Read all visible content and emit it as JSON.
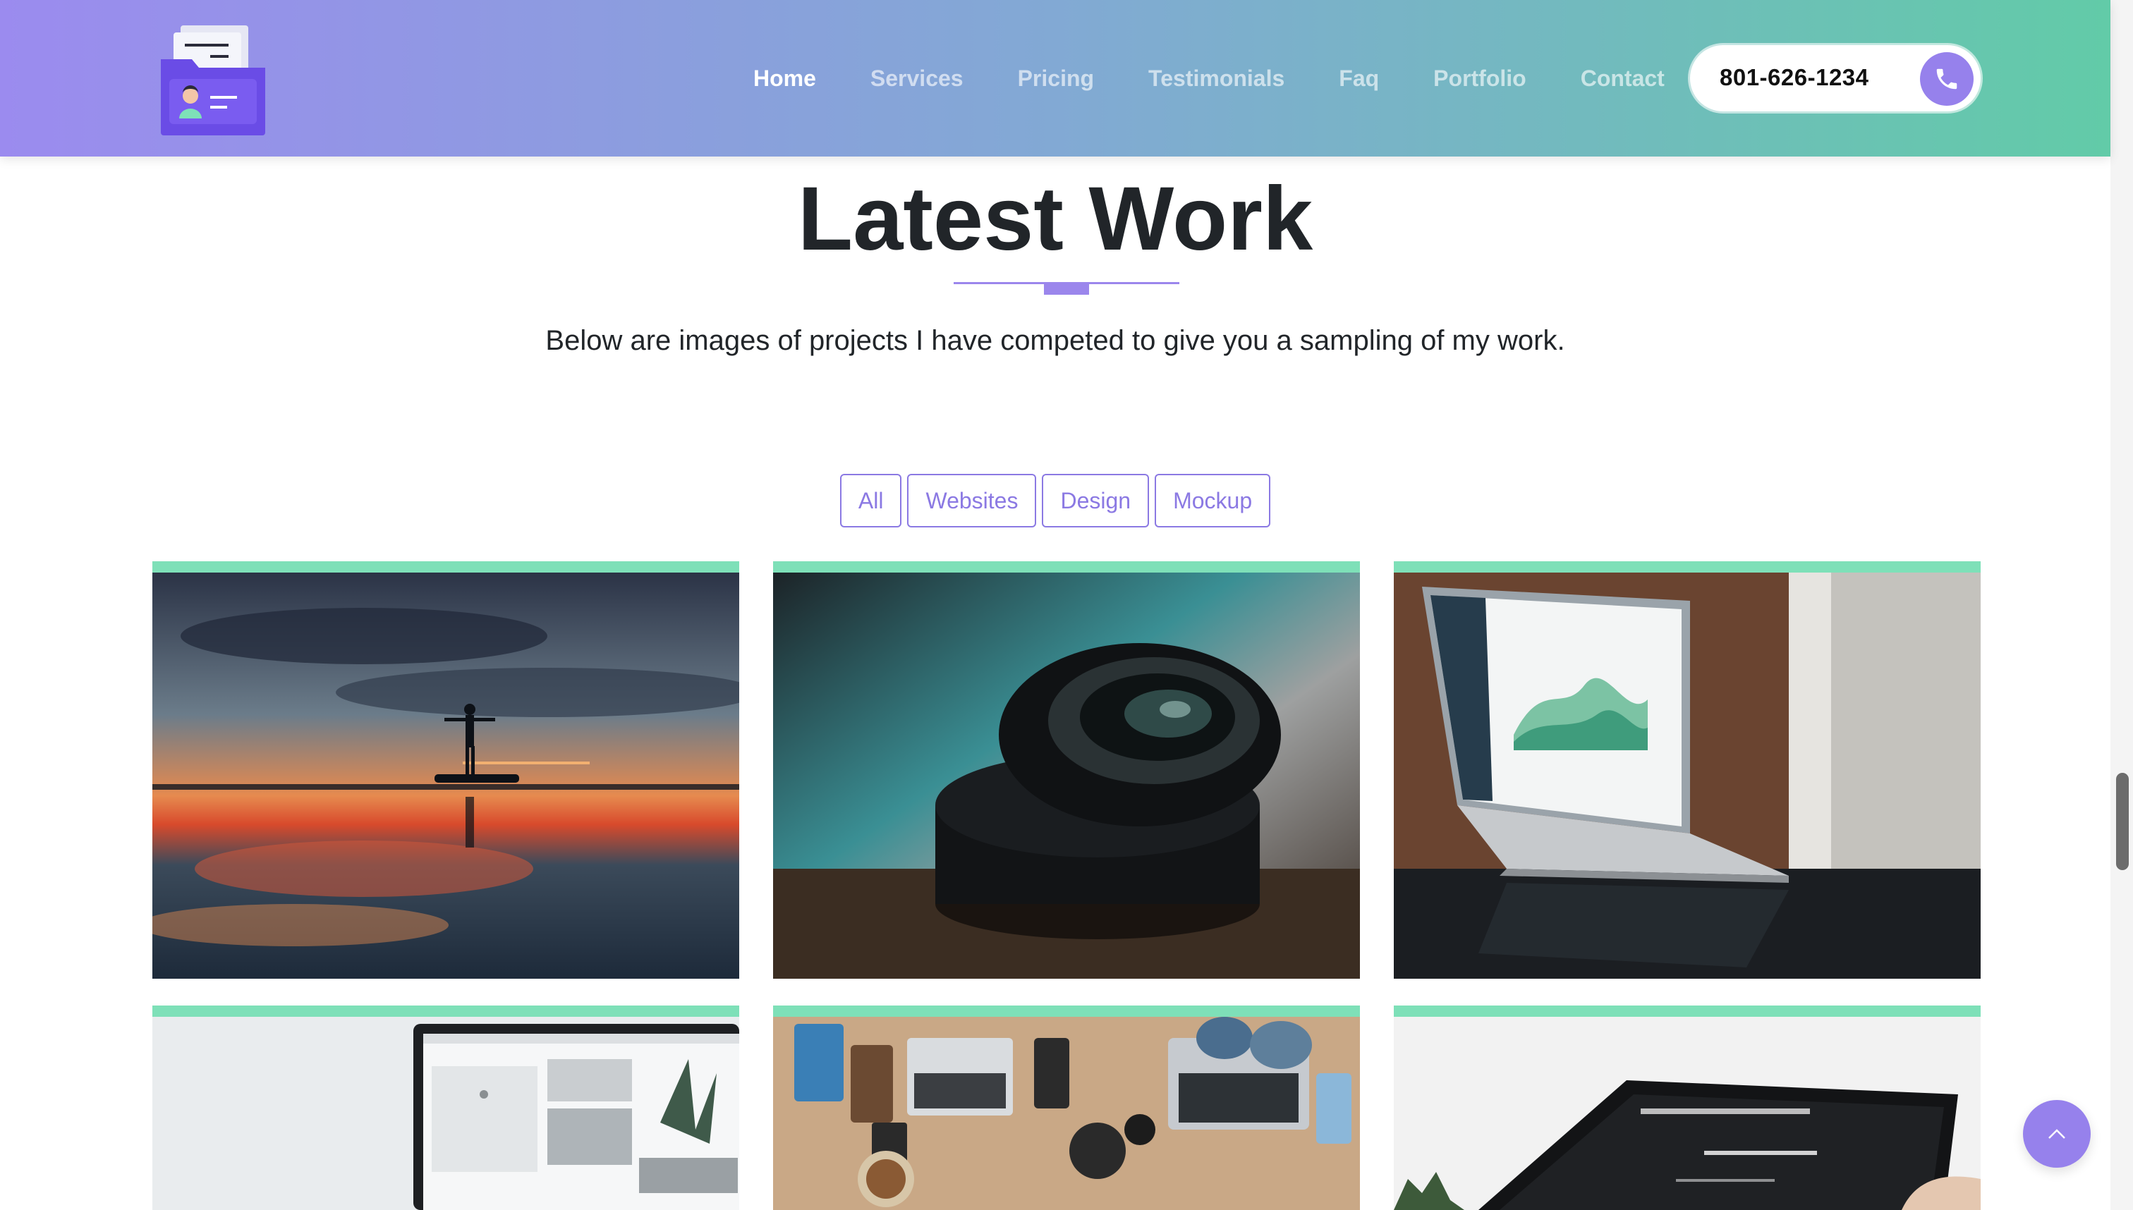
{
  "nav": {
    "items": [
      {
        "label": "Home",
        "active": true
      },
      {
        "label": "Services",
        "active": false
      },
      {
        "label": "Pricing",
        "active": false
      },
      {
        "label": "Testimonials",
        "active": false
      },
      {
        "label": "Faq",
        "active": false
      },
      {
        "label": "Portfolio",
        "active": false
      },
      {
        "label": "Contact",
        "active": false
      }
    ],
    "phone": "801-626-1234"
  },
  "section": {
    "title": "Latest Work",
    "subtitle": "Below are images of projects I have competed to give you a sampling of my work."
  },
  "filters": [
    "All",
    "Websites",
    "Design",
    "Mockup"
  ],
  "portfolio": [
    {
      "image": "sunset-reflection-photo"
    },
    {
      "image": "camera-lens-photo"
    },
    {
      "image": "laptop-dashboard-photo"
    },
    {
      "image": "laptop-website-mockup-photo"
    },
    {
      "image": "desk-workspace-photo"
    },
    {
      "image": "tablet-website-photo"
    }
  ],
  "colors": {
    "accent": "#9681ec",
    "card_accent": "#7ee0b8",
    "header_gradient": [
      "#9b8bef",
      "#62cba8"
    ]
  },
  "icons": {
    "phone": "phone-icon",
    "back_to_top": "chevron-up-icon",
    "logo": "folder-profile-logo"
  }
}
